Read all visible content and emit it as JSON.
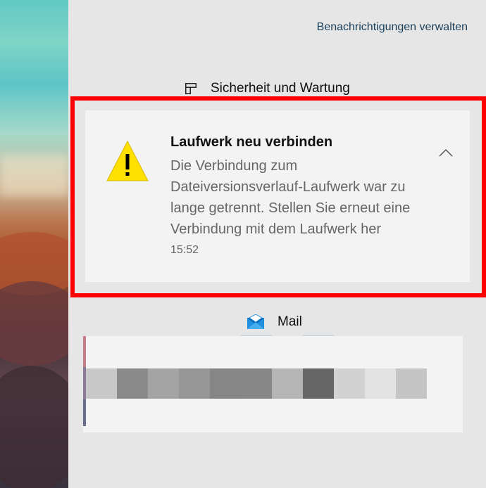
{
  "header": {
    "manage_link": "Benachrichtigungen verwalten"
  },
  "groups": {
    "security": {
      "title": "Sicherheit und Wartung"
    },
    "mail": {
      "title": "Mail"
    }
  },
  "notification": {
    "title": "Laufwerk neu verbinden",
    "body": "Die Verbindung zum Dateiversionsverlauf-Laufwerk war zu lange getrennt. Stellen Sie erneut eine Verbindung mit dem Laufwerk her",
    "time": "15:52",
    "icon": "warning-icon"
  },
  "mail_preview": {
    "pixelated_tones": [
      "#c8c8c8",
      "#8a8a8a",
      "#a4a4a4",
      "#969696",
      "#868686",
      "#878787",
      "#b5b5b5",
      "#666666",
      "#d2d2d2",
      "#e3e3e3",
      "#c5c5c5"
    ]
  },
  "colors": {
    "highlight": "#ff0000",
    "warning_fill": "#ffe000",
    "panel_bg": "#e6e6e6",
    "toast_bg": "#f3f3f3",
    "mail_icon_blue": "#1f8fe0"
  }
}
